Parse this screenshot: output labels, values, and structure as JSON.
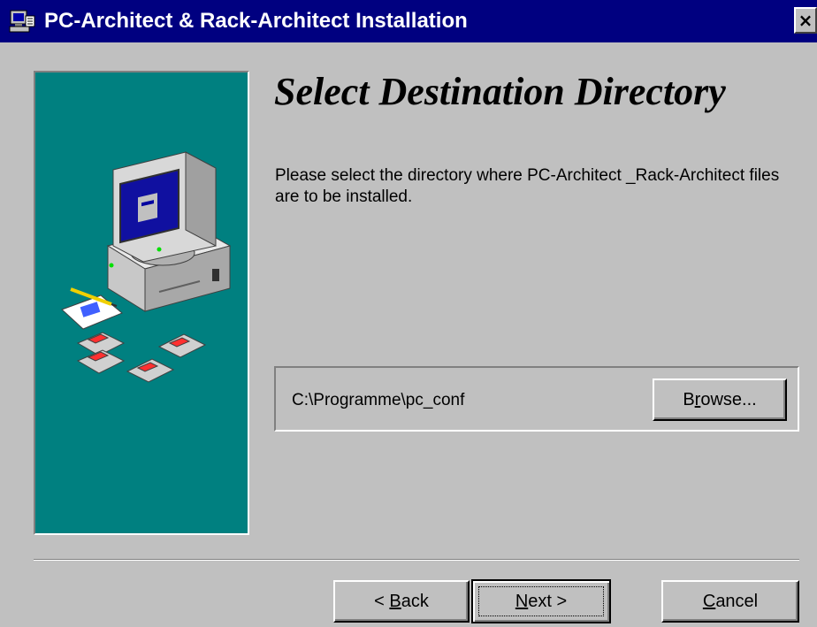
{
  "window": {
    "title": "PC-Architect & Rack-Architect Installation",
    "close_label": "×"
  },
  "wizard": {
    "heading": "Select Destination Directory",
    "description": "Please select the directory where PC-Architect _Rack-Architect files are to be installed.",
    "install_path": "C:\\Programme\\pc_conf"
  },
  "buttons": {
    "browse": {
      "pre": "B",
      "key": "r",
      "post": "owse..."
    },
    "back": {
      "pre": "< ",
      "key": "B",
      "post": "ack"
    },
    "next": {
      "pre": "",
      "key": "N",
      "post": "ext >"
    },
    "cancel": {
      "pre": "",
      "key": "C",
      "post": "ancel"
    }
  },
  "colors": {
    "titlebar": "#000080",
    "panel": "#008080",
    "face": "#c0c0c0"
  },
  "icons": {
    "title": "setup-computer-icon",
    "art": "computer-with-floppy-disks-illustration"
  }
}
